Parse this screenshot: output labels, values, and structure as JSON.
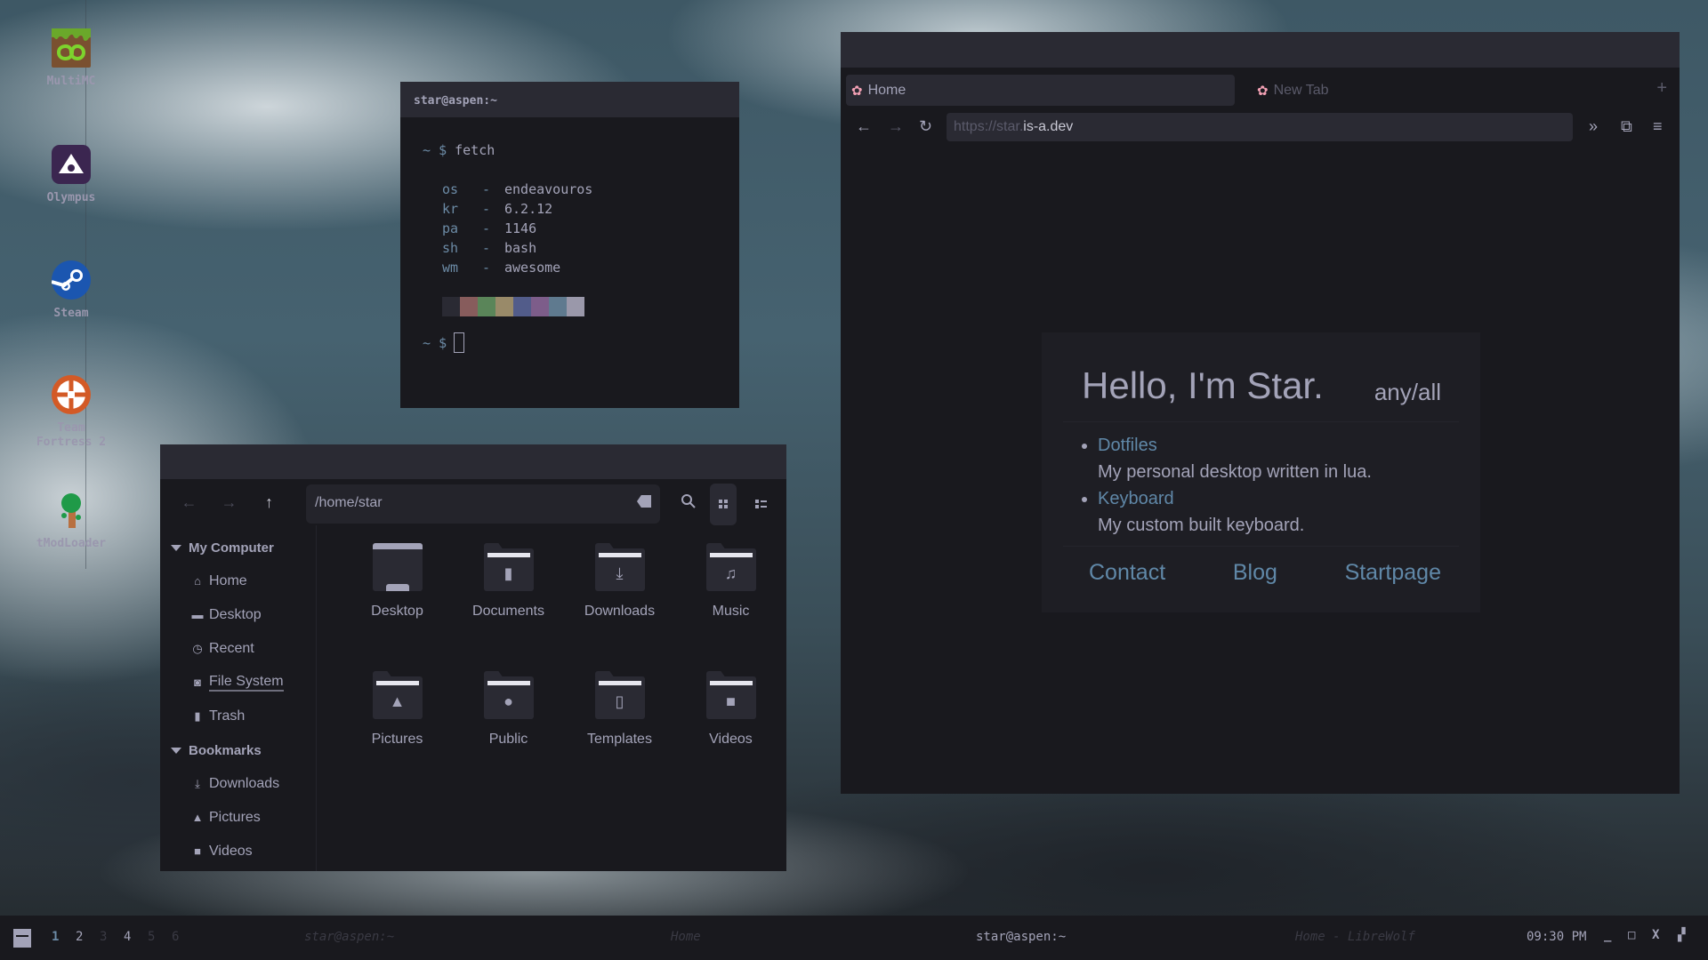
{
  "desktop": {
    "icons": [
      {
        "label": "MultiMC",
        "icon": "multimc-icon"
      },
      {
        "label": "Olympus",
        "icon": "olympus-icon"
      },
      {
        "label": "Steam",
        "icon": "steam-icon"
      },
      {
        "label": "Team Fortress 2",
        "icon": "tf2-icon"
      },
      {
        "label": "tModLoader",
        "icon": "tmodloader-icon"
      }
    ]
  },
  "terminal": {
    "title": "star@aspen:~",
    "prompt_tilde": "~",
    "prompt_dollar": "$",
    "command": "fetch",
    "fetch": [
      {
        "key": "os",
        "sep": "-",
        "value": "endeavouros"
      },
      {
        "key": "kr",
        "sep": "-",
        "value": "6.2.12"
      },
      {
        "key": "pa",
        "sep": "-",
        "value": "1146"
      },
      {
        "key": "sh",
        "sep": "-",
        "value": "bash"
      },
      {
        "key": "wm",
        "sep": "-",
        "value": "awesome"
      }
    ],
    "palette": [
      "#2a2a33",
      "#875c5c",
      "#5a8559",
      "#998a69",
      "#525c8a",
      "#7d5d8a",
      "#5f7a8f",
      "#9a98aa"
    ]
  },
  "files": {
    "nav": {
      "back": "←",
      "forward": "→",
      "up": "↑"
    },
    "path": "/home/star",
    "sidebar": {
      "sections": [
        {
          "title": "My Computer",
          "items": [
            {
              "label": "Home",
              "icon": "home-icon",
              "glyph": "⌂"
            },
            {
              "label": "Desktop",
              "icon": "desktop-icon",
              "glyph": "▬"
            },
            {
              "label": "Recent",
              "icon": "clock-icon",
              "glyph": "◷"
            },
            {
              "label": "File System",
              "icon": "drive-icon",
              "glyph": "◙"
            },
            {
              "label": "Trash",
              "icon": "trash-icon",
              "glyph": "▮"
            }
          ]
        },
        {
          "title": "Bookmarks",
          "items": [
            {
              "label": "Downloads",
              "icon": "download-icon",
              "glyph": "⤓"
            },
            {
              "label": "Pictures",
              "icon": "picture-icon",
              "glyph": "▲"
            },
            {
              "label": "Videos",
              "icon": "video-icon",
              "glyph": "■"
            }
          ]
        }
      ]
    },
    "folders": [
      {
        "name": "Desktop",
        "glyph": ""
      },
      {
        "name": "Documents",
        "glyph": "▮"
      },
      {
        "name": "Downloads",
        "glyph": "⤓"
      },
      {
        "name": "Music",
        "glyph": "♫"
      },
      {
        "name": "Pictures",
        "glyph": "▲"
      },
      {
        "name": "Public",
        "glyph": "●"
      },
      {
        "name": "Templates",
        "glyph": "▯"
      },
      {
        "name": "Videos",
        "glyph": "■"
      }
    ]
  },
  "browser": {
    "tabs": [
      {
        "label": "Home",
        "icon": "✿"
      },
      {
        "label": "New Tab",
        "icon": "✿"
      }
    ],
    "new_tab": "+",
    "nav": {
      "back": "←",
      "forward": "→",
      "reload": "↻",
      "overflow": "»",
      "extensions": "⧉",
      "menu": "≡"
    },
    "url_scheme": "https://star.",
    "url_host": "is-a.dev",
    "page": {
      "heading": "Hello, I'm Star.",
      "pronouns": "any/all",
      "projects": [
        {
          "name": "Dotfiles",
          "desc": "My personal desktop written in lua."
        },
        {
          "name": "Keyboard",
          "desc": "My custom built keyboard."
        }
      ],
      "links": [
        "Contact",
        "Blog",
        "Startpage"
      ]
    }
  },
  "taskbar": {
    "tags": [
      "1",
      "2",
      "3",
      "4",
      "5",
      "6"
    ],
    "tasks": [
      "star@aspen:~",
      "Home",
      "star@aspen:~",
      "Home - LibreWolf"
    ],
    "clock": "09:30 PM",
    "buttons": {
      "minimize": "_",
      "maximize": "□",
      "close": "X",
      "float": "▞"
    }
  }
}
